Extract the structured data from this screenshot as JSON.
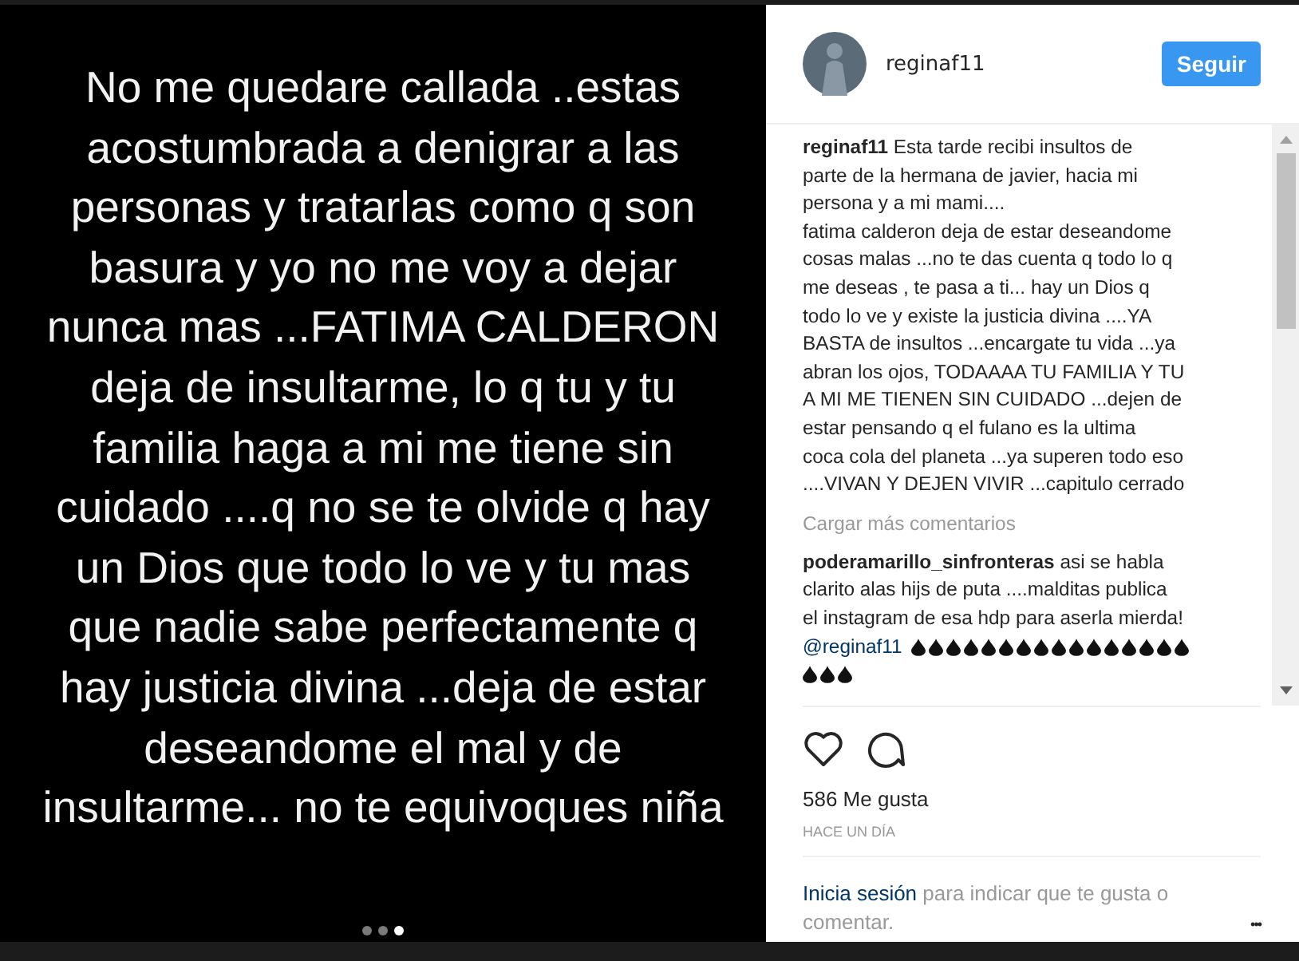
{
  "post_image": {
    "lines": [
      "No me quedare callada ..estas",
      "acostumbrada a denigrar a las",
      "personas y tratarlas como q son",
      "basura y yo no me voy a dejar",
      "nunca mas ...FATIMA CALDERON",
      "deja de insultarme, lo q tu  y tu",
      "familia haga a mi me tiene sin",
      "cuidado ....q no se te olvide q hay",
      "un Dios que todo lo ve y tu mas",
      "que nadie sabe perfectamente q",
      "hay justicia divina ...deja de estar",
      "deseandome el mal y de",
      "insultarme... no te equivoques niña"
    ],
    "dots": [
      {
        "selected": false
      },
      {
        "selected": false
      },
      {
        "selected": true
      }
    ]
  },
  "header": {
    "username": "reginaf11",
    "follow_button": "Seguir"
  },
  "caption": {
    "lines": [
      "**reginaf11** Esta tarde recibi insultos de",
      "parte de la hermana de javier, hacia mi",
      "persona y a mi mami....",
      "fatima calderon deja de estar deseandome",
      "cosas malas ...no te das cuenta q todo lo q",
      "me deseas , te pasa a ti... hay un Dios q",
      "todo lo ve y existe la justicia divina ....YA",
      "BASTA de insultos ...encargate tu vida ...ya",
      "abran los ojos, TODAAAA TU FAMILIA Y TU",
      "A MI ME TIENEN SIN CUIDADO ...dejen de",
      "estar pensando q el fulano es la ultima",
      "coca cola del planeta ...ya superen todo eso",
      "....VIVAN Y DEJEN VIVIR ...capitulo cerrado"
    ]
  },
  "load_more": "Cargar más comentarios",
  "comment": {
    "lines": [
      "**poderamarillo_sinfronteras** asi se habla",
      "clarito alas hijs de puta ....malditas publica",
      "el instagram de esa hdp para aserla mierda!"
    ],
    "mention": "@reginaf11"
  },
  "likes": "586 Me gusta",
  "time": "HACE UN DÍA",
  "login": {
    "link": "Inicia sesión",
    "text": " para indicar que te gusta o comentar."
  },
  "more_button": "•••"
}
